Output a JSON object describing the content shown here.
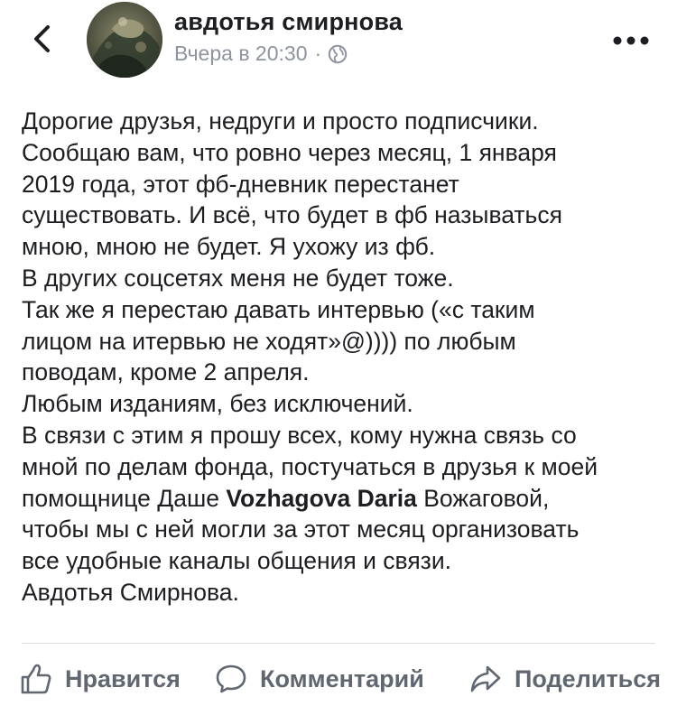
{
  "header": {
    "back_icon": "chevron-left-icon",
    "author_name": "авдотья смирнова",
    "timestamp": "Вчера в 20:30",
    "separator": "·",
    "privacy_icon": "globe-icon",
    "more_icon": "more-horizontal-icon"
  },
  "post": {
    "lines": [
      "Дорогие друзья, недруги и просто подписчики.",
      "Сообщаю вам, что ровно через месяц, 1 января",
      "2019 года, этот фб-дневник перестанет",
      "существовать. И всё, что будет в фб называться",
      "мною, мною не будет. Я ухожу из фб.",
      "В других соцсетях меня не будет тоже.",
      "Так же я перестаю давать интервью («с таким",
      "лицом на итервью не ходят»@)))) по любым",
      "поводам, кроме 2 апреля.",
      "Любым изданиям, без исключений.",
      "В связи с этим я прошу всех, кому нужна связь со",
      "мной по делам фонда, постучаться в друзья к моей"
    ],
    "mention_line": {
      "before": "помощнице Даше ",
      "mention": "Vozhagova Daria",
      "after": " Вожаговой,"
    },
    "lines_after": [
      "чтобы мы с ней могли за этот месяц организовать",
      "все удобные каналы общения и связи.",
      "Авдотья Смирнова."
    ]
  },
  "actions": {
    "like_label": "Нравится",
    "comment_label": "Комментарий",
    "share_label": "Поделиться"
  },
  "colors": {
    "text": "#1c1e21",
    "secondary": "#8d949e",
    "action": "#606770",
    "divider": "#dadde1"
  }
}
